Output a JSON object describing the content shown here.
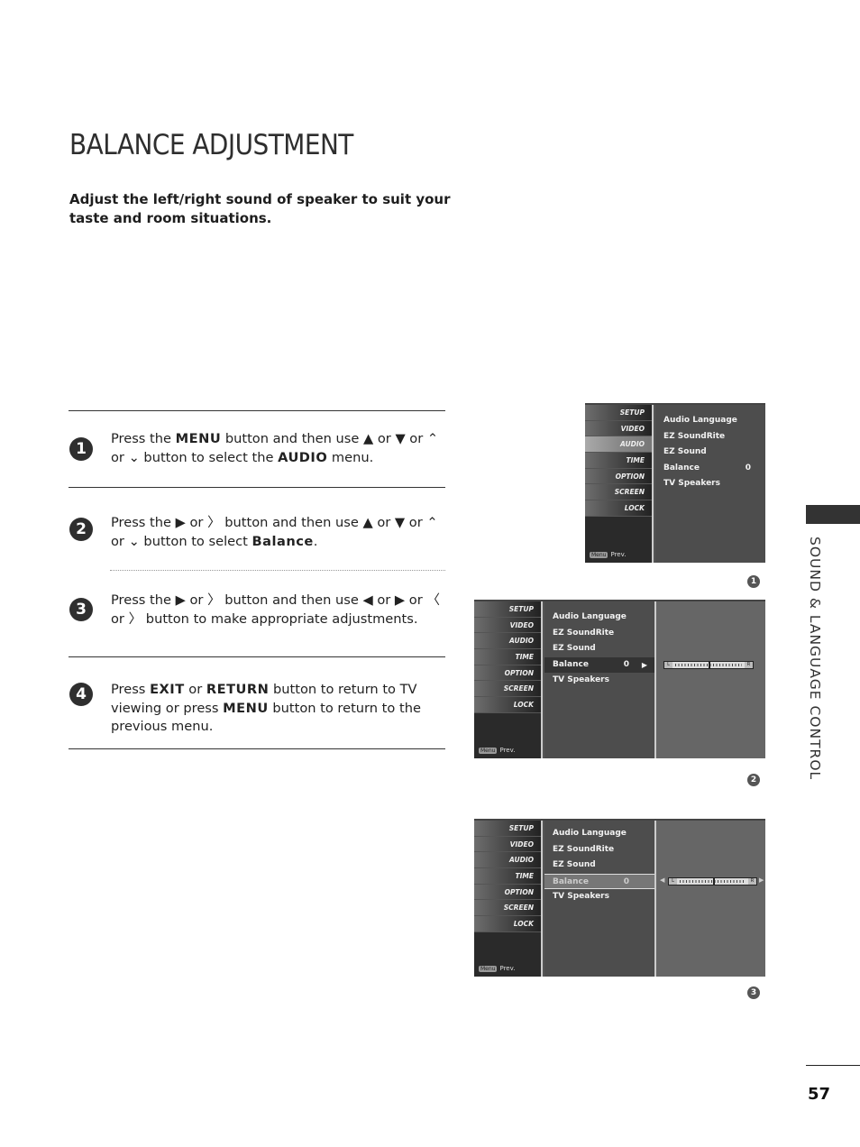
{
  "title": "BALANCE ADJUSTMENT",
  "intro": "Adjust the left/right sound of speaker to suit your taste and room situations.",
  "steps": [
    {
      "number": "1",
      "parts": [
        "Press the ",
        "MENU",
        " button and then use ▲ or ▼  or  ⌃ or ⌄  button to select the ",
        "AUDIO",
        " menu."
      ]
    },
    {
      "number": "2",
      "parts": [
        "Press the ▶  or  〉 button and then use ▲ or ▼  or ⌃ or ⌄  button to select ",
        "Balance",
        "."
      ]
    },
    {
      "number": "3",
      "parts": [
        "Press the ▶  or  〉 button and then use ◀ or ▶ or 〈  or  〉 button to make appropriate adjustments."
      ]
    },
    {
      "number": "4",
      "parts": [
        "Press ",
        "EXIT",
        " or ",
        "RETURN",
        " button to return to TV viewing or press ",
        "MENU",
        " button to return to the previous menu."
      ]
    }
  ],
  "tv_menu": {
    "sidebar": [
      "SETUP",
      "VIDEO",
      "AUDIO",
      "TIME",
      "OPTION",
      "SCREEN",
      "LOCK"
    ],
    "prev_key": "Menu",
    "prev_label": "Prev.",
    "audio_items": [
      "Audio Language",
      "EZ SoundRite",
      "EZ Sound",
      "Balance",
      "TV Speakers"
    ],
    "balance_value": "0",
    "slider_left": "L",
    "slider_right": "R",
    "balance_position": 0.5
  },
  "figures": [
    "1",
    "2",
    "3"
  ],
  "section_label": "SOUND & LANGUAGE CONTROL",
  "page_number": "57"
}
